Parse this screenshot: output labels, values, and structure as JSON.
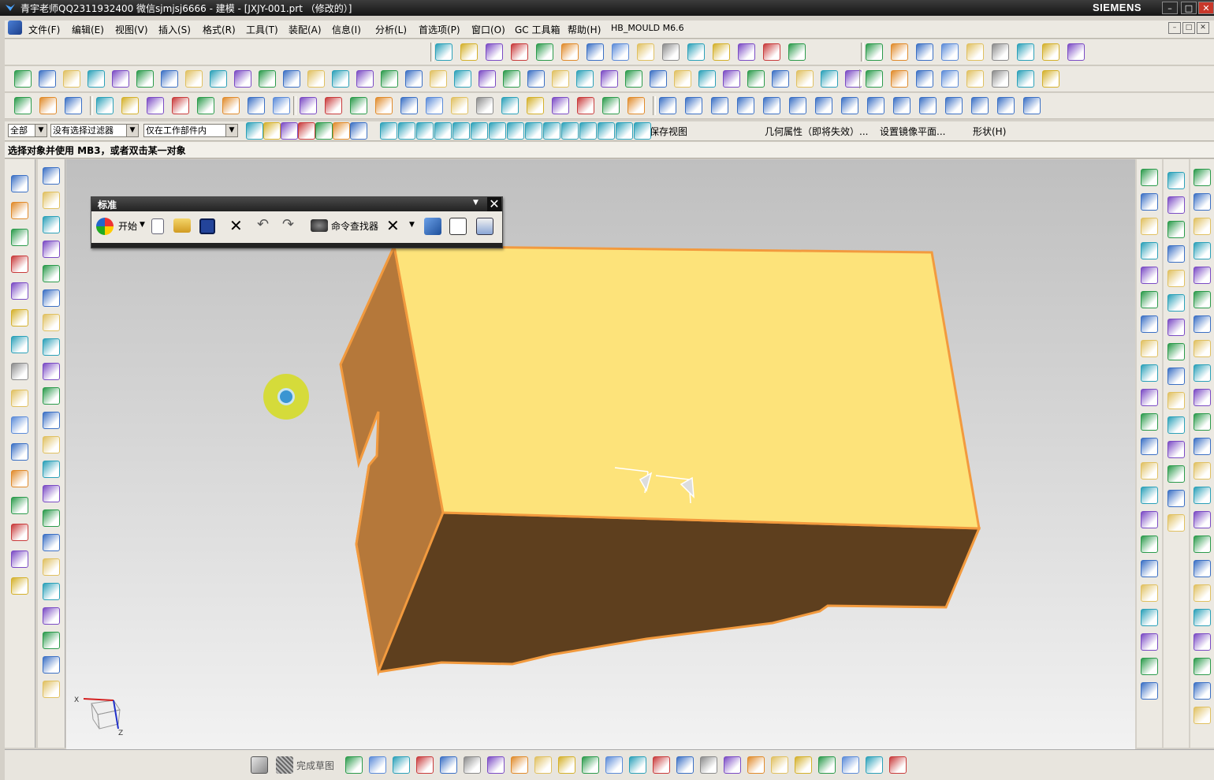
{
  "window": {
    "title": "青宇老师QQ2311932400 微信sjmjsj6666 - 建模 - [JXJY-001.prt （修改的）]",
    "brand": "SIEMENS",
    "buttons": [
      "minimize-icon",
      "maximize-icon",
      "close-icon"
    ]
  },
  "menu": {
    "items": [
      "文件(F)",
      "编辑(E)",
      "视图(V)",
      "插入(S)",
      "格式(R)",
      "工具(T)",
      "装配(A)",
      "信息(I)",
      "分析(L)",
      "首选项(P)",
      "窗口(O)",
      "GC 工具箱",
      "帮助(H)",
      "HB_MOULD M6.6"
    ]
  },
  "selection_bar": {
    "type_filter": "全部",
    "selection_filter": "没有选择过滤器",
    "scope": "仅在工作部件内",
    "save_view": "保存视图",
    "geometry_props": "几何属性（即将失效）...",
    "set_mirror_plane": "设置镜像平面...",
    "shape_menu": "形状(H)"
  },
  "cue_line": "选择对象并使用 MB3，或者双击某一对象",
  "standard_toolbar": {
    "title": "标准",
    "start_label": "开始",
    "command_finder": "命令查找器"
  },
  "sketch_toolbar": {
    "finish_sketch": "完成草图"
  },
  "triad": {
    "x": "X",
    "z": "Z"
  },
  "colors": {
    "part_top": "#fde37a",
    "part_side": "#b5783a",
    "part_front": "#5e3f1e",
    "part_edge": "#f29a3e",
    "titlebar": "#1e1e1e",
    "close_btn": "#c8382a"
  }
}
